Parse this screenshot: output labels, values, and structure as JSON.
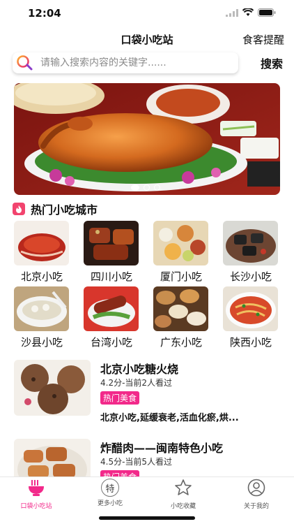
{
  "status": {
    "time": "12:04"
  },
  "nav": {
    "title": "口袋小吃站",
    "right_label": "食客提醒"
  },
  "search": {
    "placeholder": "请输入搜索内容的关键字......",
    "button_label": "搜索"
  },
  "section": {
    "title": "热门小吃城市"
  },
  "cities": [
    {
      "name": "北京小吃",
      "photo": "roast-duck-slices"
    },
    {
      "name": "四川小吃",
      "photo": "sichuan-braised-meat"
    },
    {
      "name": "厦门小吃",
      "photo": "xiamen-platter"
    },
    {
      "name": "长沙小吃",
      "photo": "stinky-tofu"
    },
    {
      "name": "沙县小吃",
      "photo": "wonton-soup"
    },
    {
      "name": "台湾小吃",
      "photo": "taiwan-sausage"
    },
    {
      "name": "广东小吃",
      "photo": "dim-sum-steamers"
    },
    {
      "name": "陕西小吃",
      "photo": "spicy-noodles"
    }
  ],
  "articles": [
    {
      "title": "北京小吃糖火烧",
      "meta": "4.2分-当前2人看过",
      "tag": "热门美食",
      "desc": "北京小吃,延缓衰老,活血化瘀,烘..."
    },
    {
      "title": "炸醋肉——闽南特色小吃",
      "meta": "4.5分-当前5人看过",
      "tag": "热门美食",
      "desc": ""
    }
  ],
  "tabs": [
    {
      "label": "口袋小吃站",
      "icon": "noodle-bowl-icon",
      "active": true
    },
    {
      "label": "更多小吃",
      "icon": "special-badge-icon",
      "icon_text": "特",
      "active": false
    },
    {
      "label": "小吃收藏",
      "icon": "star-icon",
      "active": false
    },
    {
      "label": "关于我的",
      "icon": "person-icon",
      "active": false
    }
  ],
  "colors": {
    "accent": "#f2298a",
    "fire": "#f2446e"
  }
}
